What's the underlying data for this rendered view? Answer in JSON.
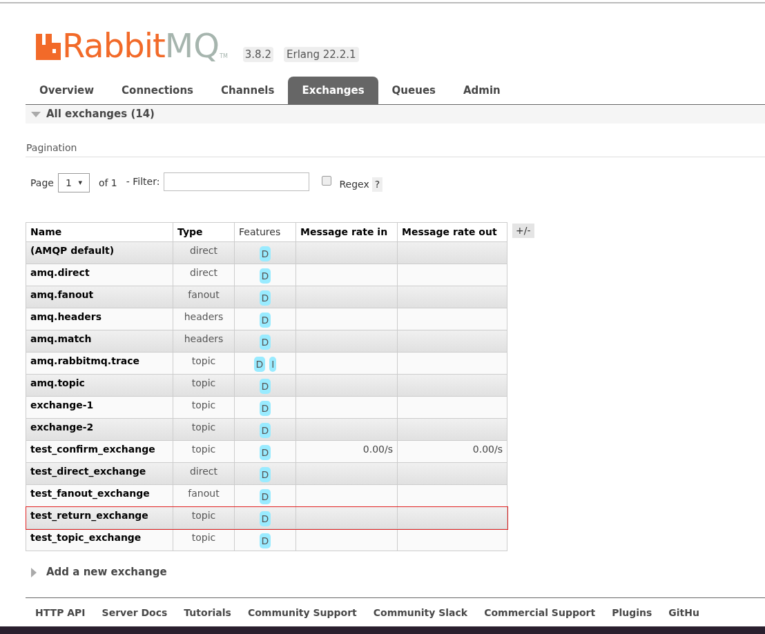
{
  "header": {
    "logo_text": "Rabbit",
    "logo_text_2": "MQ",
    "logo_tm": "TM",
    "version": "3.8.2",
    "erlang": "Erlang 22.2.1"
  },
  "tabs": [
    {
      "label": "Overview",
      "selected": false
    },
    {
      "label": "Connections",
      "selected": false
    },
    {
      "label": "Channels",
      "selected": false
    },
    {
      "label": "Exchanges",
      "selected": true
    },
    {
      "label": "Queues",
      "selected": false
    },
    {
      "label": "Admin",
      "selected": false
    }
  ],
  "section": {
    "title": "All exchanges (14)",
    "expanded": true
  },
  "pagination": {
    "heading": "Pagination",
    "page_label": "Page",
    "page_value": "1",
    "caret": "▾",
    "of_label": "of 1",
    "filter_label": "- Filter:",
    "regex_label": "Regex",
    "regex_checked": false,
    "help": "?"
  },
  "table": {
    "columns": [
      "Name",
      "Type",
      "Features",
      "Message rate in",
      "Message rate out"
    ],
    "toggle": "+/-",
    "rows": [
      {
        "name": "(AMQP default)",
        "type": "direct",
        "features": [
          "D"
        ],
        "rate_in": "",
        "rate_out": "",
        "highlighted": false
      },
      {
        "name": "amq.direct",
        "type": "direct",
        "features": [
          "D"
        ],
        "rate_in": "",
        "rate_out": "",
        "highlighted": false
      },
      {
        "name": "amq.fanout",
        "type": "fanout",
        "features": [
          "D"
        ],
        "rate_in": "",
        "rate_out": "",
        "highlighted": false
      },
      {
        "name": "amq.headers",
        "type": "headers",
        "features": [
          "D"
        ],
        "rate_in": "",
        "rate_out": "",
        "highlighted": false
      },
      {
        "name": "amq.match",
        "type": "headers",
        "features": [
          "D"
        ],
        "rate_in": "",
        "rate_out": "",
        "highlighted": false
      },
      {
        "name": "amq.rabbitmq.trace",
        "type": "topic",
        "features": [
          "D",
          "I"
        ],
        "rate_in": "",
        "rate_out": "",
        "highlighted": false
      },
      {
        "name": "amq.topic",
        "type": "topic",
        "features": [
          "D"
        ],
        "rate_in": "",
        "rate_out": "",
        "highlighted": false
      },
      {
        "name": "exchange-1",
        "type": "topic",
        "features": [
          "D"
        ],
        "rate_in": "",
        "rate_out": "",
        "highlighted": false
      },
      {
        "name": "exchange-2",
        "type": "topic",
        "features": [
          "D"
        ],
        "rate_in": "",
        "rate_out": "",
        "highlighted": false
      },
      {
        "name": "test_confirm_exchange",
        "type": "topic",
        "features": [
          "D"
        ],
        "rate_in": "0.00/s",
        "rate_out": "0.00/s",
        "highlighted": false
      },
      {
        "name": "test_direct_exchange",
        "type": "direct",
        "features": [
          "D"
        ],
        "rate_in": "",
        "rate_out": "",
        "highlighted": false
      },
      {
        "name": "test_fanout_exchange",
        "type": "fanout",
        "features": [
          "D"
        ],
        "rate_in": "",
        "rate_out": "",
        "highlighted": false
      },
      {
        "name": "test_return_exchange",
        "type": "topic",
        "features": [
          "D"
        ],
        "rate_in": "",
        "rate_out": "",
        "highlighted": true
      },
      {
        "name": "test_topic_exchange",
        "type": "topic",
        "features": [
          "D"
        ],
        "rate_in": "",
        "rate_out": "",
        "highlighted": false
      }
    ]
  },
  "add_section": {
    "title": "Add a new exchange",
    "expanded": false
  },
  "footer": {
    "links": [
      "HTTP API",
      "Server Docs",
      "Tutorials",
      "Community Support",
      "Community Slack",
      "Commercial Support",
      "Plugins",
      "GitHu"
    ]
  }
}
